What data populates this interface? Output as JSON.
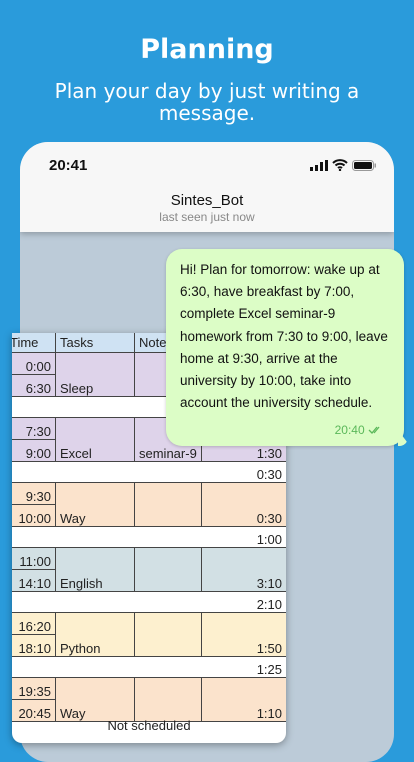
{
  "header": {
    "title": "Planning",
    "subtitle": "Plan your day by just writing a message."
  },
  "status_bar": {
    "time": "20:41",
    "icons": [
      "signal-icon",
      "wifi-icon",
      "battery-icon"
    ]
  },
  "chat": {
    "name": "Sintes_Bot",
    "status": "last seen just now"
  },
  "message": {
    "text": "Hi! Plan for tomorrow: wake up at 6:30, have breakfast by 7:00, complete Excel seminar-9 homework from 7:30 to 9:00, leave home at 9:30, arrive at the university by 10:00, take into account the university schedule.",
    "time": "20:40",
    "status_icon": "double-check-icon"
  },
  "table": {
    "headers": [
      "Time",
      "Tasks",
      "Notes",
      ""
    ],
    "blocks": [
      {
        "start": "0:00",
        "end": "6:30",
        "task": "Sleep",
        "note": "",
        "duration": "",
        "color": "#ded3ea"
      },
      {
        "gap": ""
      },
      {
        "start": "7:30",
        "end": "9:00",
        "task": "Excel",
        "note": "seminar-9",
        "duration": "1:30",
        "color": "#ded3ea"
      },
      {
        "gap": "0:30"
      },
      {
        "start": "9:30",
        "end": "10:00",
        "task": "Way",
        "note": "",
        "duration": "0:30",
        "color": "#fbe3cc"
      },
      {
        "gap": "1:00"
      },
      {
        "start": "11:00",
        "end": "14:10",
        "task": "English",
        "note": "",
        "duration": "3:10",
        "color": "#d2e0e4"
      },
      {
        "gap": "2:10"
      },
      {
        "start": "16:20",
        "end": "18:10",
        "task": "Python",
        "note": "",
        "duration": "1:50",
        "color": "#fdf0cf"
      },
      {
        "gap": "1:25"
      },
      {
        "start": "19:35",
        "end": "20:45",
        "task": "Way",
        "note": "",
        "duration": "1:10",
        "color": "#fbe3cc"
      }
    ],
    "footer": "Not scheduled"
  }
}
